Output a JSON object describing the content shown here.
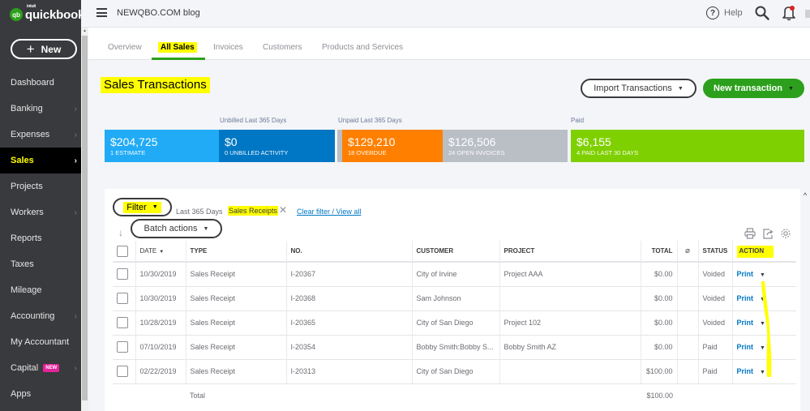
{
  "app": {
    "logo_brand": "quickbooks",
    "logo_intuit": "intuit",
    "logo_badge": "qb",
    "company_name": "NEWQBO.COM blog"
  },
  "sidebar": {
    "new_button": "New",
    "items": [
      {
        "label": "Dashboard",
        "chevron": false,
        "active": false
      },
      {
        "label": "Banking",
        "chevron": true,
        "active": false
      },
      {
        "label": "Expenses",
        "chevron": true,
        "active": false
      },
      {
        "label": "Sales",
        "chevron": true,
        "active": true
      },
      {
        "label": "Projects",
        "chevron": false,
        "active": false
      },
      {
        "label": "Workers",
        "chevron": true,
        "active": false
      },
      {
        "label": "Reports",
        "chevron": false,
        "active": false
      },
      {
        "label": "Taxes",
        "chevron": false,
        "active": false
      },
      {
        "label": "Mileage",
        "chevron": false,
        "active": false
      },
      {
        "label": "Accounting",
        "chevron": true,
        "active": false
      },
      {
        "label": "My Accountant",
        "chevron": false,
        "active": false
      },
      {
        "label": "Capital",
        "chevron": true,
        "active": false,
        "badge": "NEW"
      },
      {
        "label": "Apps",
        "chevron": false,
        "active": false
      }
    ]
  },
  "topbar": {
    "help_label": "Help",
    "help_icon": "?"
  },
  "tabs": [
    {
      "label": "Overview",
      "active": false
    },
    {
      "label": "All Sales",
      "active": true
    },
    {
      "label": "Invoices",
      "active": false
    },
    {
      "label": "Customers",
      "active": false
    },
    {
      "label": "Products and Services",
      "active": false
    }
  ],
  "page": {
    "title": "Sales Transactions",
    "import_button": "Import Transactions",
    "new_transaction_button": "New transaction"
  },
  "money_bar": {
    "labels": {
      "unbilled": "Unbilled Last 365 Days",
      "unpaid": "Unpaid Last 365 Days",
      "paid": "Paid"
    },
    "cards": [
      {
        "amount": "$204,725",
        "caption": "1 ESTIMATE",
        "color": "#21abf6"
      },
      {
        "amount": "$0",
        "caption": "0 UNBILLED ACTIVITY",
        "color": "#0077c5"
      },
      {
        "amount": "$129,210",
        "caption": "18 OVERDUE",
        "color": "#ff8000"
      },
      {
        "amount": "$126,506",
        "caption": "24 OPEN INVOICES",
        "color": "#babec5"
      },
      {
        "amount": "$6,155",
        "caption": "4 PAID LAST 30 DAYS",
        "color": "#7fd000"
      }
    ]
  },
  "filters": {
    "filter_button": "Filter",
    "date_range": "Last 365 Days",
    "active_chip": "Sales Receipts",
    "clear_link": "Clear filter / View all",
    "batch_button": "Batch actions"
  },
  "table": {
    "columns": [
      "DATE",
      "TYPE",
      "NO.",
      "CUSTOMER",
      "PROJECT",
      "TOTAL",
      "",
      "STATUS",
      "ACTION"
    ],
    "rows": [
      {
        "date": "10/30/2019",
        "type": "Sales Receipt",
        "no": "I-20367",
        "customer": "City of Irvine",
        "project": "Project AAA",
        "total": "$0.00",
        "status": "Voided",
        "action": "Print"
      },
      {
        "date": "10/30/2019",
        "type": "Sales Receipt",
        "no": "I-20368",
        "customer": "Sam Johnson",
        "project": "",
        "total": "$0.00",
        "status": "Voided",
        "action": "Print"
      },
      {
        "date": "10/28/2019",
        "type": "Sales Receipt",
        "no": "I-20365",
        "customer": "City of San Diego",
        "project": "Project 102",
        "total": "$0.00",
        "status": "Voided",
        "action": "Print"
      },
      {
        "date": "07/10/2019",
        "type": "Sales Receipt",
        "no": "I-20354",
        "customer": "Bobby Smith:Bobby S...",
        "project": "Bobby Smith AZ",
        "total": "$0.00",
        "status": "Paid",
        "action": "Print"
      },
      {
        "date": "02/22/2019",
        "type": "Sales Receipt",
        "no": "I-20313",
        "customer": "City of San Diego",
        "project": "",
        "total": "$100.00",
        "status": "Paid",
        "action": "Print"
      }
    ],
    "total_label": "Total",
    "total_value": "$100.00"
  },
  "colors": {
    "brand_green": "#2ca01c",
    "sidebar_bg": "#393a3d",
    "link_blue": "#0077c5",
    "highlight_yellow": "#ffff00",
    "badge_pink": "#e5249b"
  }
}
